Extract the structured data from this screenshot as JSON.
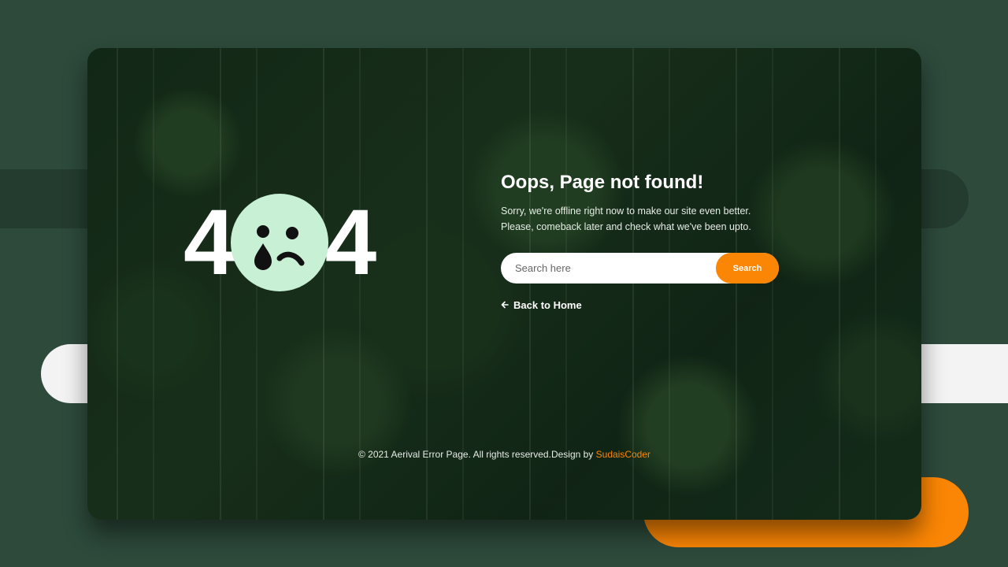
{
  "page": {
    "error_code_left": "4",
    "error_code_right": "4",
    "face_icon": "crying-face-icon",
    "title": "Oops, Page not found!",
    "description": "Sorry, we're offline right now to make our site even better. Please, comeback later and check what we've been upto.",
    "search": {
      "placeholder": "Search here",
      "value": "",
      "button_label": "Search"
    },
    "back_link": {
      "icon": "arrow-left-icon",
      "label": "Back to Home"
    }
  },
  "footer": {
    "text": "© 2021 Aerival Error Page. All rights reserved.Design by ",
    "credit": "SudaisCoder"
  },
  "colors": {
    "background": "#2d4a3b",
    "accent": "#fb8605",
    "face": "#c8f0d5",
    "text": "#ffffff"
  }
}
